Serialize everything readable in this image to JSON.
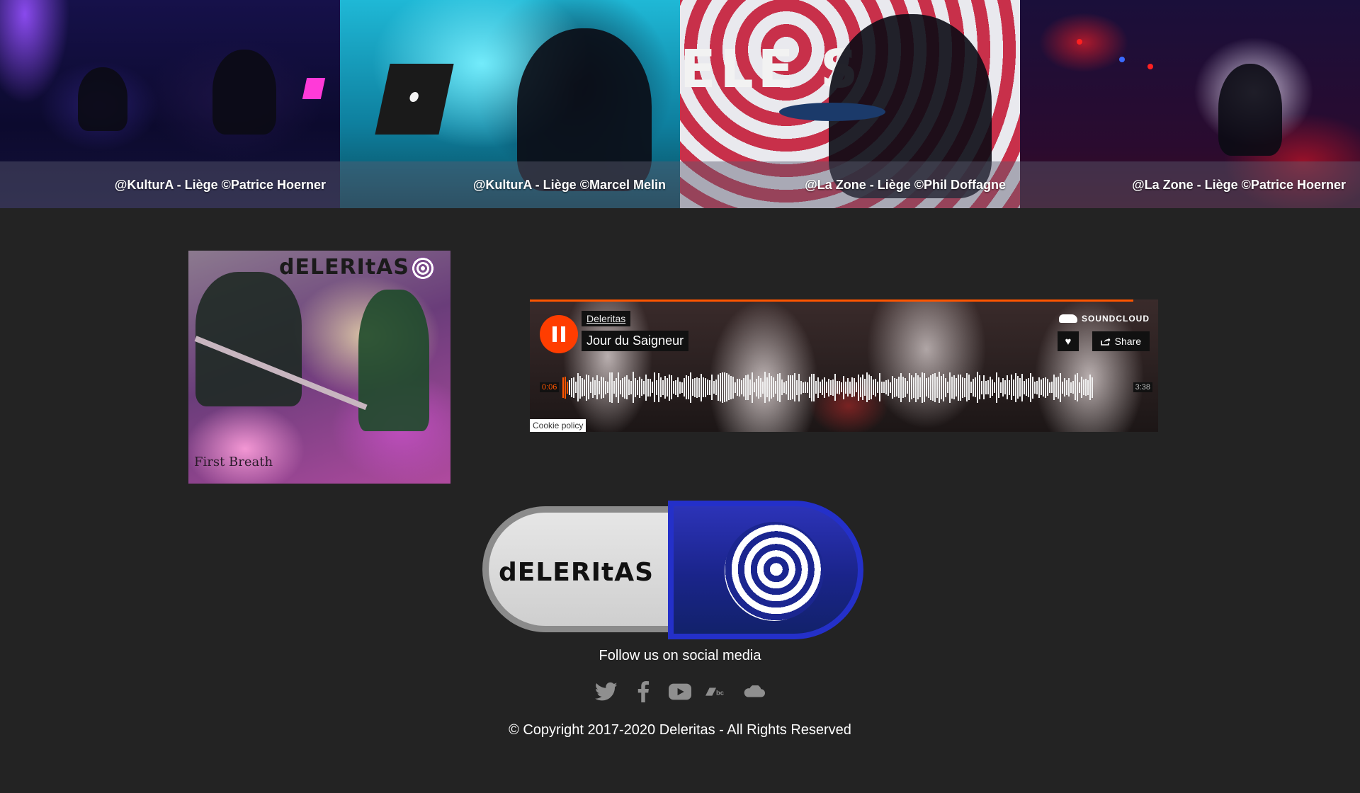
{
  "gallery": {
    "photos": [
      {
        "caption": "@KulturA - Liège ©Patrice Hoerner"
      },
      {
        "caption": "@KulturA - Liège ©Marcel Melin"
      },
      {
        "caption": "@La Zone - Liège ©Phil Doffagne"
      },
      {
        "caption": "@La Zone - Liège ©Patrice Hoerner"
      }
    ],
    "backdrop_text": "ELE S"
  },
  "album": {
    "band_text": "dELERItAS",
    "subtitle": "First Breath"
  },
  "player": {
    "artist": "Deleritas",
    "track": "Jour du Saigneur",
    "brand": "SOUNDCLOUD",
    "share_label": "Share",
    "current_time": "0:06",
    "duration": "3:38",
    "cookie_label": "Cookie policy",
    "accent": "#ff5500",
    "state": "playing",
    "icons": {
      "play": "pause-icon",
      "like": "heart-icon",
      "share": "share-icon",
      "brand": "soundcloud-icon"
    }
  },
  "logo": {
    "text": "dELERItAS",
    "icon": "spiral-icon"
  },
  "footer": {
    "follow_text": "Follow us on social media",
    "socials": [
      "twitter-icon",
      "facebook-icon",
      "youtube-icon",
      "bandcamp-icon",
      "soundcloud-icon"
    ],
    "copyright": "© Copyright 2017-2020 Deleritas - All Rights Reserved"
  }
}
